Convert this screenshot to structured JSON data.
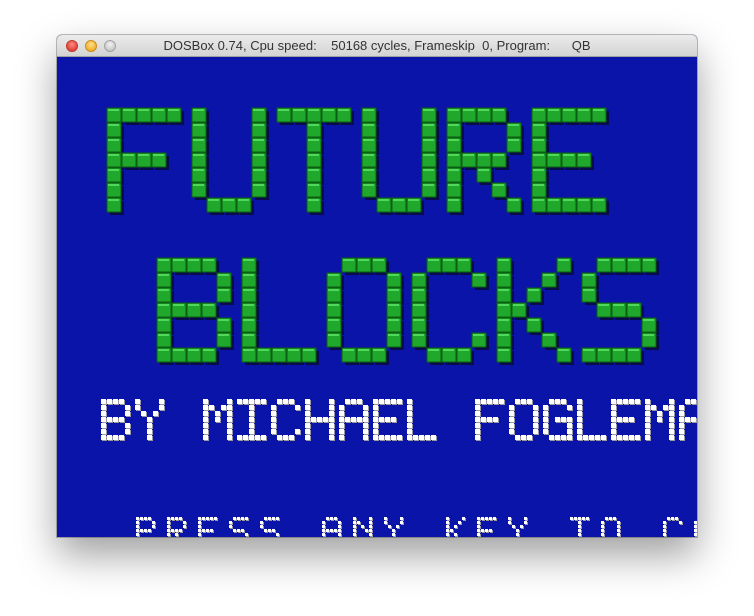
{
  "window": {
    "title": "DOSBox 0.74, Cpu speed:    50168 cycles, Frameskip  0, Program:      QB"
  },
  "colors": {
    "screen_bg": "#0a14a8",
    "block_green": "#1fa82b",
    "block_shadow": "#080d4a",
    "text_white": "#ffffff",
    "text_gray": "#9a9aa6"
  },
  "game": {
    "title_line1": "FUTURE",
    "title_line2": "BLOCKS",
    "byline": "BY MICHAEL FOGLEMAN",
    "prompt": "PRESS ANY KEY TO CONTINUE"
  }
}
